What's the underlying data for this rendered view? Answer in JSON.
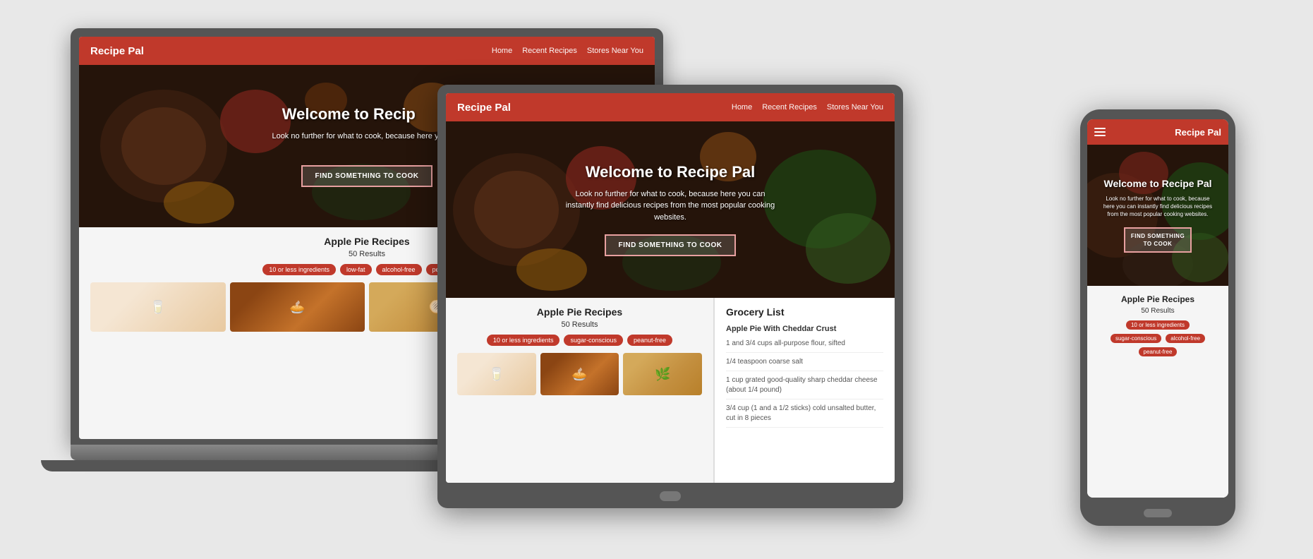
{
  "brand": "Recipe Pal",
  "nav": {
    "home": "Home",
    "recent": "Recent Recipes",
    "stores": "Stores Near You"
  },
  "hero": {
    "title": "Welcome to Recipe Pal",
    "subtitle": "Look no further for what to cook, because here you can instantly find delicious recipes from the most popular cooking websites.",
    "button": "FIND SOMETHING TO COOK"
  },
  "recipe": {
    "title": "Apple Pie Recipes",
    "count": "50 Results",
    "tags_laptop": [
      "10 or less ingredients",
      "low-fat",
      "alcohol-free",
      "peanut-free"
    ],
    "tags_tablet": [
      "10 or less ingredients",
      "sugar-conscious",
      "peanut-free"
    ],
    "tags_phone": [
      "10 or less ingredients",
      "sugar-conscious",
      "alcohol-free",
      "peanut-free"
    ]
  },
  "grocery": {
    "title": "Grocery List",
    "recipe_name": "Apple Pie With Cheddar Crust",
    "items": [
      "1 and 3/4 cups all-purpose flour, sifted",
      "1/4 teaspoon coarse salt",
      "1 cup grated good-quality sharp cheddar cheese (about 1/4 pound)",
      "3/4 cup (1 and a 1/2 sticks) cold unsalted butter, cut in 8 pieces"
    ]
  }
}
